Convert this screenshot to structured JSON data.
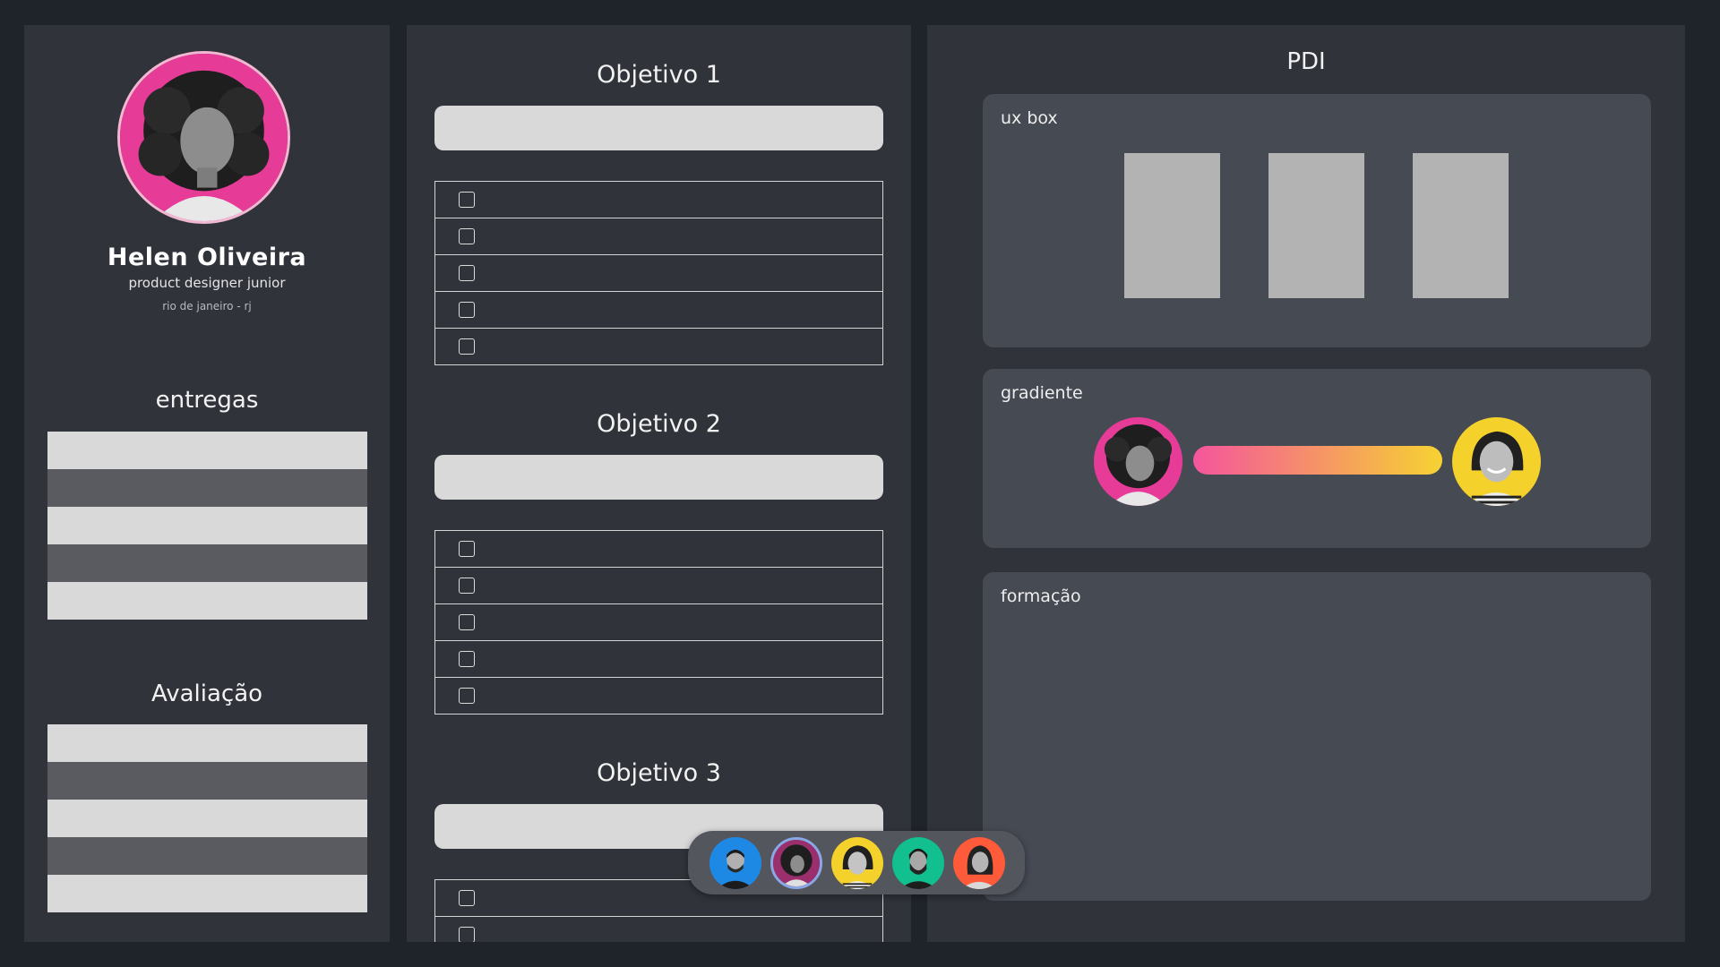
{
  "profile": {
    "name": "Helen Oliveira",
    "role": "product designer junior",
    "location": "rio de janeiro - rj"
  },
  "sections": {
    "entregas": "entregas",
    "avaliacao": "Avaliação"
  },
  "objectives": [
    {
      "title": "Objetivo 1",
      "checkbox_count": 5
    },
    {
      "title": "Objetivo 2",
      "checkbox_count": 5
    },
    {
      "title": "Objetivo 3",
      "checkbox_count": 2
    }
  ],
  "pdi": {
    "title": "PDI",
    "cards": {
      "uxbox": "ux box",
      "gradiente": "gradiente",
      "formacao": "formação"
    },
    "gradient_colors": [
      "#f5559c",
      "#f6d232"
    ]
  },
  "collaborators": [
    {
      "ring_color": "#1e88e5"
    },
    {
      "ring_color": "#9b2f6e"
    },
    {
      "ring_color": "#f5d12c"
    },
    {
      "ring_color": "#11c08e"
    },
    {
      "ring_color": "#ff5a3a"
    }
  ],
  "colors": {
    "background": "#1f232a",
    "panel": "#30333a",
    "card": "#464a53",
    "profile_accent": "#e63c98",
    "gradient_to_accent": "#f5d12c"
  }
}
